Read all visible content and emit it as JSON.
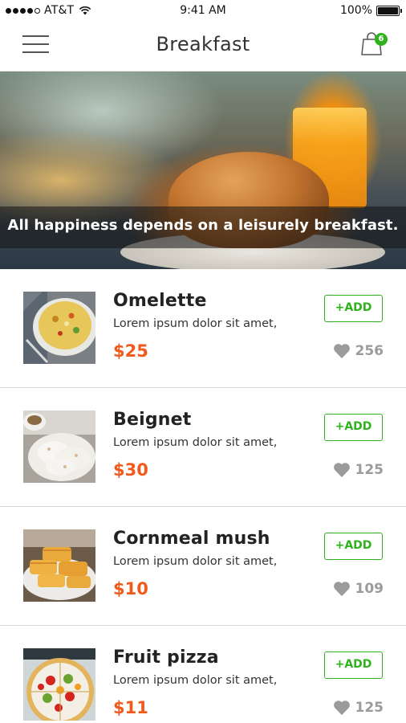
{
  "status_bar": {
    "carrier": "AT&T",
    "time": "9:41 AM",
    "battery": "100%",
    "icons": [
      "signal-dots-icon",
      "wifi-icon",
      "battery-icon"
    ]
  },
  "header": {
    "title": "Breakfast",
    "menu_icon": "hamburger-menu-icon",
    "cart_icon": "shopping-bag-icon",
    "cart_count": "6",
    "accent_color": "#2fb31c"
  },
  "hero": {
    "caption": "All happiness depends on a leisurely breakfast."
  },
  "items": [
    {
      "name": "Omelette",
      "description": "Lorem ipsum dolor sit amet,",
      "price": "$25",
      "add_label": "+ADD",
      "likes": "256",
      "thumb": "omelette"
    },
    {
      "name": "Beignet",
      "description": "Lorem ipsum dolor sit amet,",
      "price": "$30",
      "add_label": "+ADD",
      "likes": "125",
      "thumb": "beignet"
    },
    {
      "name": "Cornmeal mush",
      "description": "Lorem ipsum dolor sit amet,",
      "price": "$10",
      "add_label": "+ADD",
      "likes": "109",
      "thumb": "cornmeal-mush"
    },
    {
      "name": "Fruit pizza",
      "description": "Lorem ipsum dolor sit amet,",
      "price": "$11",
      "add_label": "+ADD",
      "likes": "125",
      "thumb": "fruit-pizza"
    }
  ],
  "colors": {
    "price": "#f05a1a",
    "add_button": "#2fb31c",
    "likes": "#9b9b9b"
  }
}
